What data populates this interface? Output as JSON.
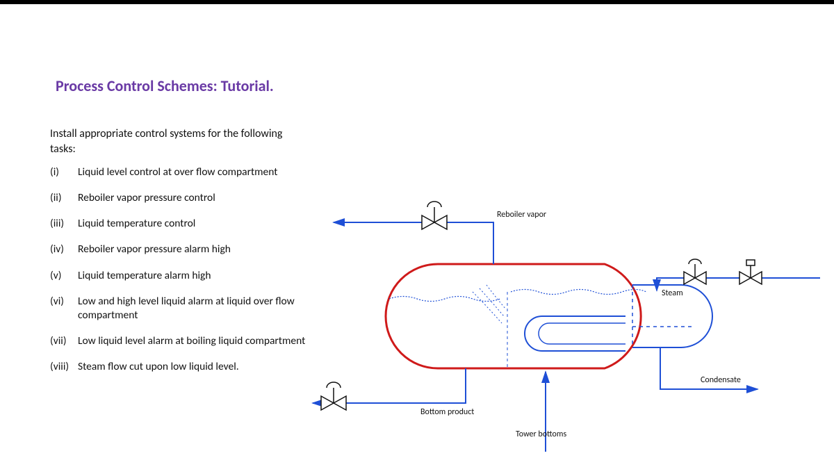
{
  "title": "Process Control Schemes: Tutorial.",
  "subtitle": "Install appropriate control systems for the following tasks:",
  "tasks": [
    {
      "num": "(i)",
      "text": "Liquid level control at over flow compartment"
    },
    {
      "num": "(ii)",
      "text": "Reboiler vapor pressure control"
    },
    {
      "num": "(iii)",
      "text": "Liquid temperature control"
    },
    {
      "num": "(iv)",
      "text": "Reboiler vapor pressure alarm high"
    },
    {
      "num": "(v)",
      "text": "Liquid temperature alarm high"
    },
    {
      "num": "(vi)",
      "text": "Low and high level liquid alarm at liquid over flow compartment"
    },
    {
      "num": "(vii)",
      "text": "Low liquid level alarm at boiling liquid compartment"
    },
    {
      "num": "(viii)",
      "text": "Steam flow cut upon low liquid level."
    }
  ],
  "labels": {
    "reboiler_vapor": "Reboiler vapor",
    "steam": "Steam",
    "condensate": "Condensate",
    "bottom_product": "Bottom product",
    "tower_bottoms": "Tower bottoms"
  }
}
